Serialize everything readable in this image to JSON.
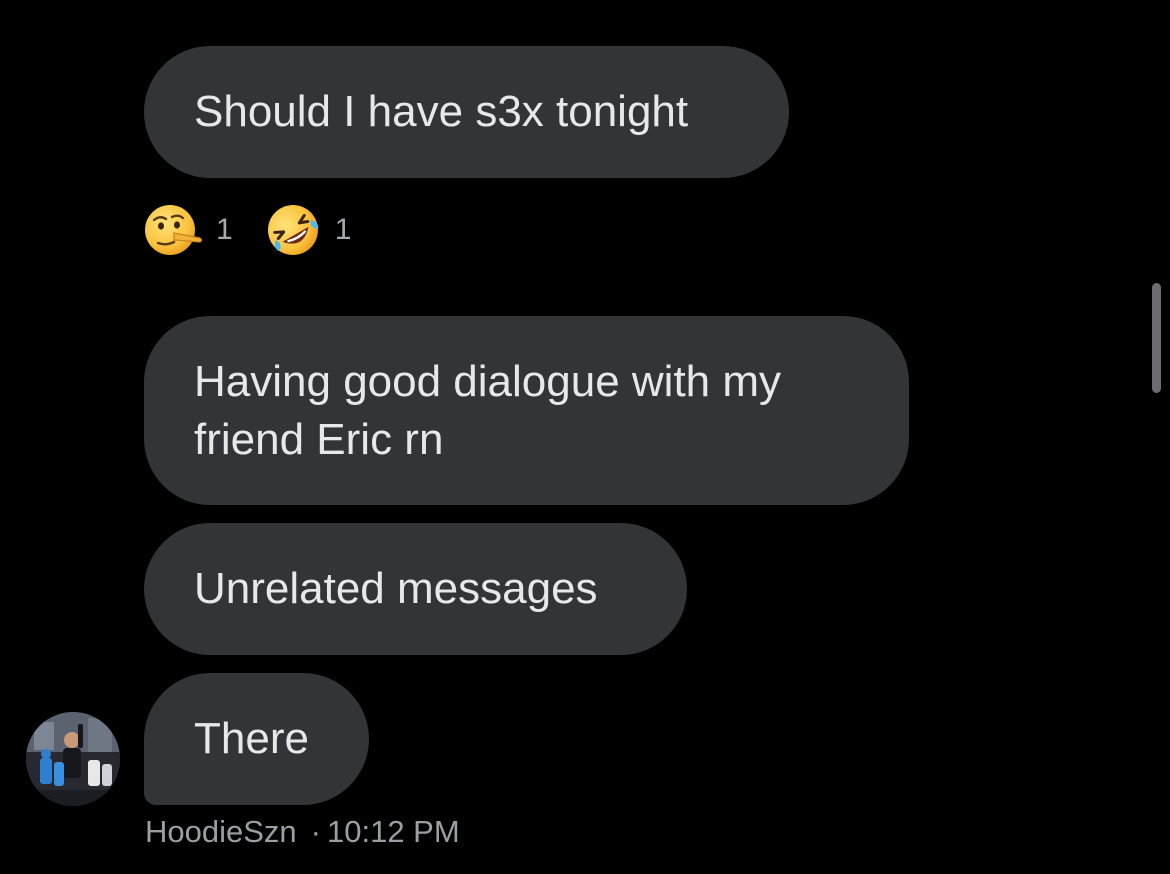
{
  "messages": [
    {
      "text": "Should I have s3x tonight"
    },
    {
      "text": "Having good dialogue with my\nfriend Eric rn"
    },
    {
      "text": "Unrelated messages"
    },
    {
      "text": "There"
    }
  ],
  "reactions": [
    {
      "icon": "lying-face-emoji-icon",
      "count": "1"
    },
    {
      "icon": "rolling-on-floor-laughing-emoji-icon",
      "count": "1"
    }
  ],
  "sender": {
    "name": "HoodieSzn",
    "separator": "·",
    "time": "10:12 PM"
  },
  "colors": {
    "background": "#000000",
    "bubble": "#323438",
    "bubble_text": "#e7e8ea",
    "meta_text": "#9c9ea3"
  }
}
